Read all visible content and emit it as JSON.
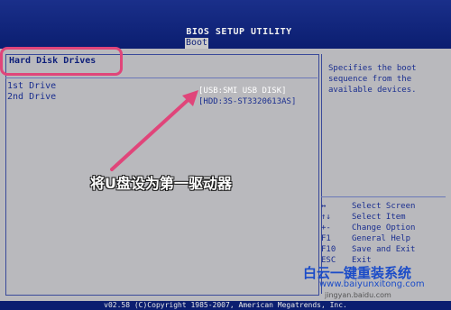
{
  "bios": {
    "title": "BIOS SETUP UTILITY",
    "active_tab": "Boot"
  },
  "section": {
    "title": "Hard Disk Drives"
  },
  "drives": [
    {
      "label": "1st Drive",
      "value": "[USB:SMI USB DISK]"
    },
    {
      "label": "2nd Drive",
      "value": "[HDD:3S-ST3320613AS]"
    }
  ],
  "help": {
    "description": "Specifies the boot sequence from the available devices."
  },
  "keys": [
    {
      "key": "↔",
      "action": "Select Screen"
    },
    {
      "key": "↑↓",
      "action": "Select Item"
    },
    {
      "key": "+-",
      "action": "Change Option"
    },
    {
      "key": "F1",
      "action": "General Help"
    },
    {
      "key": "F10",
      "action": "Save and Exit"
    },
    {
      "key": "ESC",
      "action": "Exit"
    }
  ],
  "footer": {
    "copyright": "v02.58 (C)Copyright 1985-2007, American Megatrends, Inc."
  },
  "annotation": {
    "text": "将U盘设为第一驱动器"
  },
  "watermark": {
    "brand": "白云一键重装系统",
    "url": "www.baiyunxitong.com",
    "small": "jingyan.baidu.com"
  },
  "colors": {
    "bios_blue": "#0a1f6e",
    "panel_gray": "#b9b9bd",
    "highlight_pink": "#e0457a"
  }
}
